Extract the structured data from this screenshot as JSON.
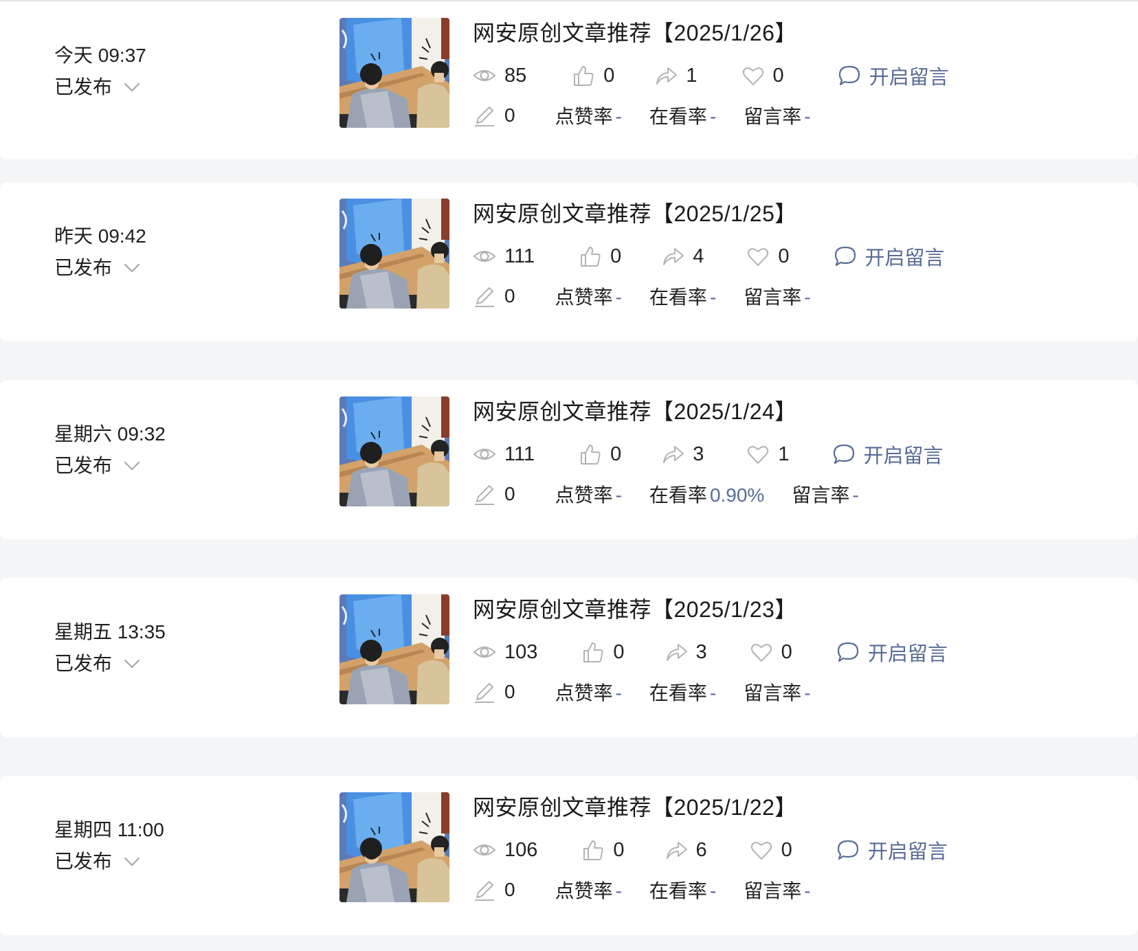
{
  "labels": {
    "status_published": "已发布",
    "open_comments": "开启留言",
    "like_rate": "点赞率",
    "watch_rate": "在看率",
    "comment_rate": "留言率"
  },
  "colors": {
    "link_blue": "#576b95",
    "icon_gray": "#b3b3b3",
    "page_bg": "#f4f5f7"
  },
  "articles": [
    {
      "time": "今天 09:37",
      "title": "网安原创文章推荐【2025/1/26】",
      "views": "85",
      "likes": "0",
      "shares": "1",
      "favorites": "0",
      "edits": "0",
      "like_rate": "-",
      "watch_rate": "-",
      "comment_rate": "-"
    },
    {
      "time": "昨天 09:42",
      "title": "网安原创文章推荐【2025/1/25】",
      "views": "111",
      "likes": "0",
      "shares": "4",
      "favorites": "0",
      "edits": "0",
      "like_rate": "-",
      "watch_rate": "-",
      "comment_rate": "-"
    },
    {
      "time": "星期六 09:32",
      "title": "网安原创文章推荐【2025/1/24】",
      "views": "111",
      "likes": "0",
      "shares": "3",
      "favorites": "1",
      "edits": "0",
      "like_rate": "-",
      "watch_rate": "0.90%",
      "comment_rate": "-"
    },
    {
      "time": "星期五 13:35",
      "title": "网安原创文章推荐【2025/1/23】",
      "views": "103",
      "likes": "0",
      "shares": "3",
      "favorites": "0",
      "edits": "0",
      "like_rate": "-",
      "watch_rate": "-",
      "comment_rate": "-"
    },
    {
      "time": "星期四 11:00",
      "title": "网安原创文章推荐【2025/1/22】",
      "views": "106",
      "likes": "0",
      "shares": "6",
      "favorites": "0",
      "edits": "0",
      "like_rate": "-",
      "watch_rate": "-",
      "comment_rate": "-"
    }
  ]
}
